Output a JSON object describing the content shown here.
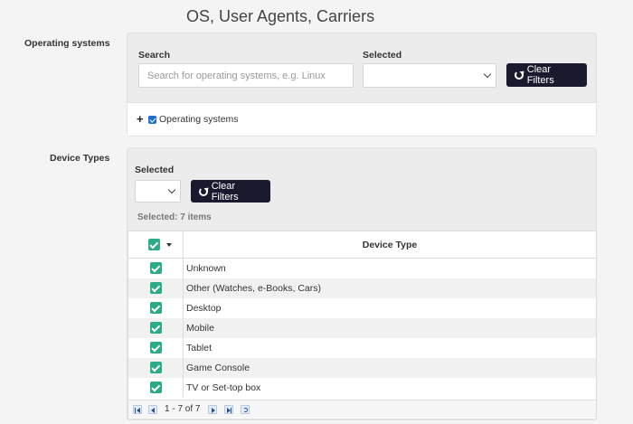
{
  "page_title": "OS, User Agents, Carriers",
  "os_section": {
    "label": "Operating systems",
    "search_label": "Search",
    "search_placeholder": "Search for operating systems, e.g. Linux",
    "search_value": "",
    "selected_label": "Selected",
    "selected_value": "",
    "clear_button": "Clear Filters",
    "tree_item": "Operating systems",
    "tree_item_checked": true
  },
  "device_section": {
    "label": "Device Types",
    "selected_label": "Selected",
    "selected_value": "",
    "clear_button": "Clear Filters",
    "selected_info": "Selected: 7 items",
    "table": {
      "column_header": "Device Type",
      "rows": [
        {
          "label": "Unknown",
          "checked": true
        },
        {
          "label": "Other (Watches, e-Books, Cars)",
          "checked": true
        },
        {
          "label": "Desktop",
          "checked": true
        },
        {
          "label": "Mobile",
          "checked": true
        },
        {
          "label": "Tablet",
          "checked": true
        },
        {
          "label": "Game Console",
          "checked": true
        },
        {
          "label": "TV or Set-top box",
          "checked": true
        }
      ]
    },
    "pager_text": "1 - 7 of 7"
  },
  "colors": {
    "checkbox_green": "#2bab88",
    "button_dark": "#1a1a2e",
    "small_checkbox_blue": "#1b6fd2"
  }
}
